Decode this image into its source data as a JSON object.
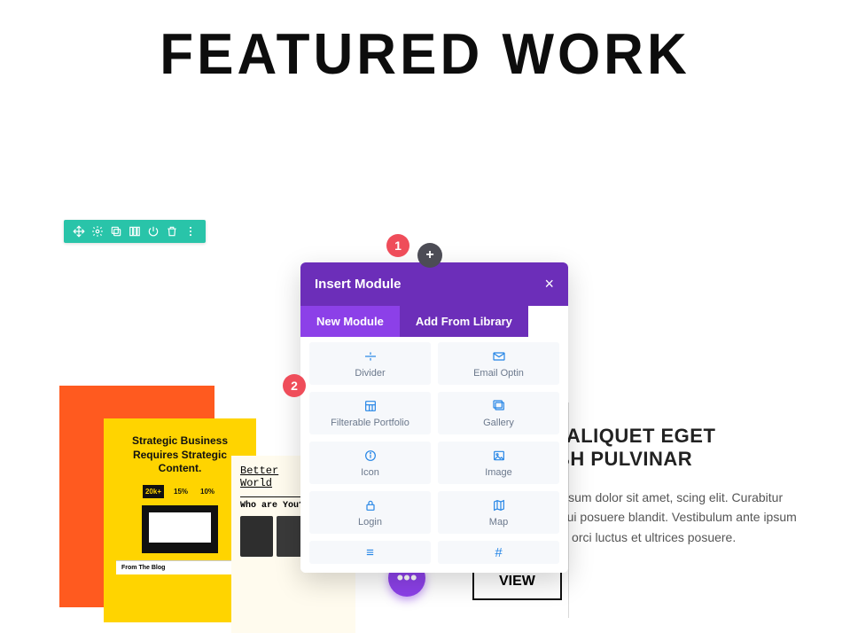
{
  "heading": "FEATURED WORK",
  "badges": {
    "one": "1",
    "two": "2"
  },
  "toolbar": {
    "icons": [
      "move",
      "gear",
      "duplicate",
      "columns",
      "power",
      "trash",
      "dots"
    ]
  },
  "plus_btn": "+",
  "modal": {
    "title": "Insert Module",
    "close": "×",
    "tabs": {
      "new": "New Module",
      "library": "Add From Library"
    },
    "tiles": [
      {
        "name": "Divider",
        "icon": "divider"
      },
      {
        "name": "Email Optin",
        "icon": "email"
      },
      {
        "name": "Filterable Portfolio",
        "icon": "grid"
      },
      {
        "name": "Gallery",
        "icon": "image-multi"
      },
      {
        "name": "Icon",
        "icon": "circle-i"
      },
      {
        "name": "Image",
        "icon": "image"
      },
      {
        "name": "Login",
        "icon": "lock"
      },
      {
        "name": "Map",
        "icon": "map"
      }
    ],
    "footer_icons": {
      "left": "≡",
      "right": "#"
    }
  },
  "bg_cards": {
    "yellow": {
      "title": "Strategic Business Requires Strategic Content.",
      "stats": [
        "20k+",
        "15%",
        "10%"
      ],
      "blog_label": "From The Blog"
    },
    "cream": {
      "line1": "Better",
      "line2": "World",
      "question": "Who are You?"
    }
  },
  "right": {
    "heading_l1": "BLANDIT ALIQUET EGET",
    "heading_l2": "OUNT NIBH PULVINAR",
    "body": "or risus. Lorem ipsum dolor sit amet, scing elit. Curabitur aliquet quam id dui posuere blandit. Vestibulum ante ipsum primis in faucibus orci luctus et ultrices posuere.",
    "button": "VIEW"
  },
  "fab": "•••",
  "colors": {
    "purple": "#6c2eb9",
    "purple_light": "#8c40e8",
    "teal": "#29c4a9",
    "orange": "#ff5a1f",
    "yellow": "#ffd400",
    "badge": "#ef4d5a",
    "icon_blue": "#2585e6"
  }
}
